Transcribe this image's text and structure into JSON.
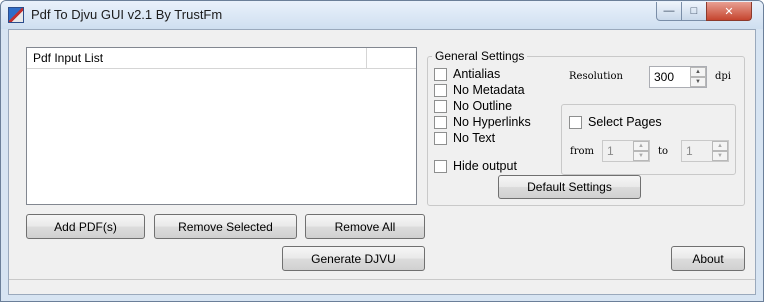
{
  "window": {
    "title": "Pdf To Djvu GUI v2.1 By TrustFm",
    "minimize": "—",
    "maximize": "□",
    "close": "✕"
  },
  "list": {
    "columns": [
      "Pdf Input List",
      ""
    ]
  },
  "buttons": {
    "add": "Add PDF(s)",
    "remove_selected": "Remove Selected",
    "remove_all": "Remove All",
    "generate": "Generate DJVU",
    "about": "About",
    "default_settings": "Default Settings"
  },
  "settings": {
    "legend": "General Settings",
    "options": [
      "Antialias",
      "No Metadata",
      "No Outline",
      "No Hyperlinks",
      "No Text"
    ],
    "hide_output": "Hide output",
    "resolution_label": "Resolution",
    "resolution_value": "300",
    "resolution_unit": "dpi",
    "select_pages": "Select Pages",
    "from_label": "from",
    "from_value": "1",
    "to_label": "to",
    "to_value": "1"
  },
  "icons": {
    "app": "pdf-djvu-app-icon",
    "spin_up": "▲",
    "spin_down": "▼"
  }
}
